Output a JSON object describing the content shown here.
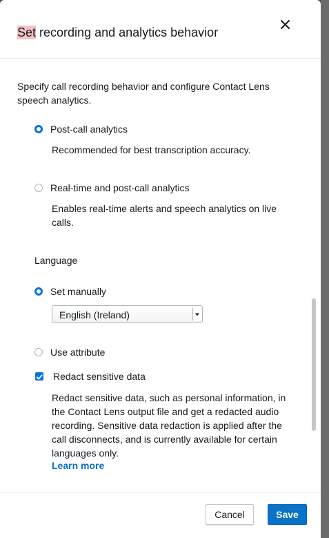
{
  "dialog": {
    "title_highlight": "Set",
    "title_rest": " recording and analytics behavior",
    "description": "Specify call recording behavior and configure Contact Lens speech analytics."
  },
  "analytics_options": [
    {
      "label": "Post-call analytics",
      "hint": "Recommended for best transcription accuracy.",
      "selected": true
    },
    {
      "label": "Real-time and post-call analytics",
      "hint": "Enables real-time alerts and speech analytics on live calls.",
      "selected": false
    }
  ],
  "language": {
    "heading": "Language",
    "set_manually_label": "Set manually",
    "set_manually_selected": true,
    "select_value": "English (Ireland)",
    "use_attribute_label": "Use attribute",
    "use_attribute_selected": false
  },
  "redact": {
    "label": "Redact sensitive data",
    "checked": true,
    "description": "Redact sensitive data, such as personal information, in the Contact Lens output file and get a redacted audio recording. Sensitive data redaction is applied after the call disconnects, and is currently available for certain languages only.",
    "link": "Learn more"
  },
  "footer": {
    "cancel_label": "Cancel",
    "save_label": "Save"
  },
  "colors": {
    "accent": "#0a73d9",
    "title_highlight": "#f5c2c3",
    "link": "#0a6ebd"
  },
  "icons": {
    "close": "close-icon",
    "check": "checkmark-icon",
    "dropdown": "dropdown-arrow-icon"
  }
}
